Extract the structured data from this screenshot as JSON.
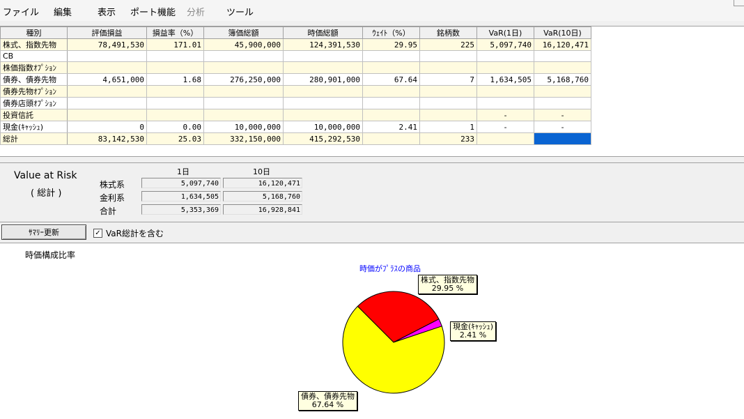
{
  "menu": {
    "items": [
      {
        "label": "ファイル",
        "enabled": true
      },
      {
        "label": "編集",
        "enabled": true
      },
      {
        "label": "表示",
        "enabled": true
      },
      {
        "label": "ポート機能",
        "enabled": true
      },
      {
        "label": "分析",
        "enabled": false
      },
      {
        "label": "ツール",
        "enabled": true
      }
    ]
  },
  "table": {
    "headers": [
      "種別",
      "評価損益",
      "損益率（%）",
      "簿価総額",
      "時価総額",
      "ｳｪｲﾄ（%）",
      "銘柄数",
      "VaR(1日)",
      "VaR(10日)"
    ],
    "rows": [
      {
        "name": "株式、指数先物",
        "cells": [
          "78,491,530",
          "171.01",
          "45,900,000",
          "124,391,530",
          "29.95",
          "225",
          "5,097,740",
          "16,120,471"
        ]
      },
      {
        "name": "CB",
        "cells": [
          "",
          "",
          "",
          "",
          "",
          "",
          "",
          ""
        ]
      },
      {
        "name": "株価指数ｵﾌﾟｼｮﾝ",
        "cells": [
          "",
          "",
          "",
          "",
          "",
          "",
          "",
          ""
        ]
      },
      {
        "name": "債券、債券先物",
        "cells": [
          "4,651,000",
          "1.68",
          "276,250,000",
          "280,901,000",
          "67.64",
          "7",
          "1,634,505",
          "5,168,760"
        ]
      },
      {
        "name": "債券先物ｵﾌﾟｼｮﾝ",
        "cells": [
          "",
          "",
          "",
          "",
          "",
          "",
          "",
          ""
        ]
      },
      {
        "name": "債券店頭ｵﾌﾟｼｮﾝ",
        "cells": [
          "",
          "",
          "",
          "",
          "",
          "",
          "",
          ""
        ]
      },
      {
        "name": "投資信託",
        "cells": [
          "",
          "",
          "",
          "",
          "",
          "",
          "-",
          "-"
        ]
      },
      {
        "name": "現金(ｷｬｯｼｭ)",
        "cells": [
          "0",
          "0.00",
          "10,000,000",
          "10,000,000",
          "2.41",
          "1",
          "-",
          "-"
        ]
      },
      {
        "name": "総計",
        "cells": [
          "83,142,530",
          "25.03",
          "332,150,000",
          "415,292,530",
          "",
          "233",
          "",
          ""
        ]
      }
    ]
  },
  "var": {
    "title": "Value at Risk",
    "subtitle": "( 総計 )",
    "col1": "1日",
    "col10": "10日",
    "rows": [
      {
        "label": "株式系",
        "d1": "5,097,740",
        "d10": "16,120,471"
      },
      {
        "label": "金利系",
        "d1": "1,634,505",
        "d10": "5,168,760"
      },
      {
        "label": "合計",
        "d1": "5,353,369",
        "d10": "16,928,841"
      }
    ]
  },
  "summary": {
    "update_button": "ｻﾏﾘｰ更新",
    "checkbox_label": "VaR総計を含む",
    "checkbox_checked": true,
    "checkbox_mark": "✓"
  },
  "chart_caption": "時価構成比率",
  "chart_data": {
    "type": "pie",
    "title": "時価がﾌﾟﾗｽの商品",
    "slices": [
      {
        "label": "株式、指数先物",
        "percent_label": "29.95 %",
        "value": 29.95,
        "color": "#ff0000"
      },
      {
        "label": "現金(ｷｬｯｼｭ)",
        "percent_label": "2.41 %",
        "value": 2.41,
        "color": "#ff00ff"
      },
      {
        "label": "債券、債券先物",
        "percent_label": "67.64 %",
        "value": 67.64,
        "color": "#ffff00"
      }
    ]
  },
  "colors": {
    "highlight_cell": "#0a64d2",
    "row_tint": "#fffbe0"
  }
}
